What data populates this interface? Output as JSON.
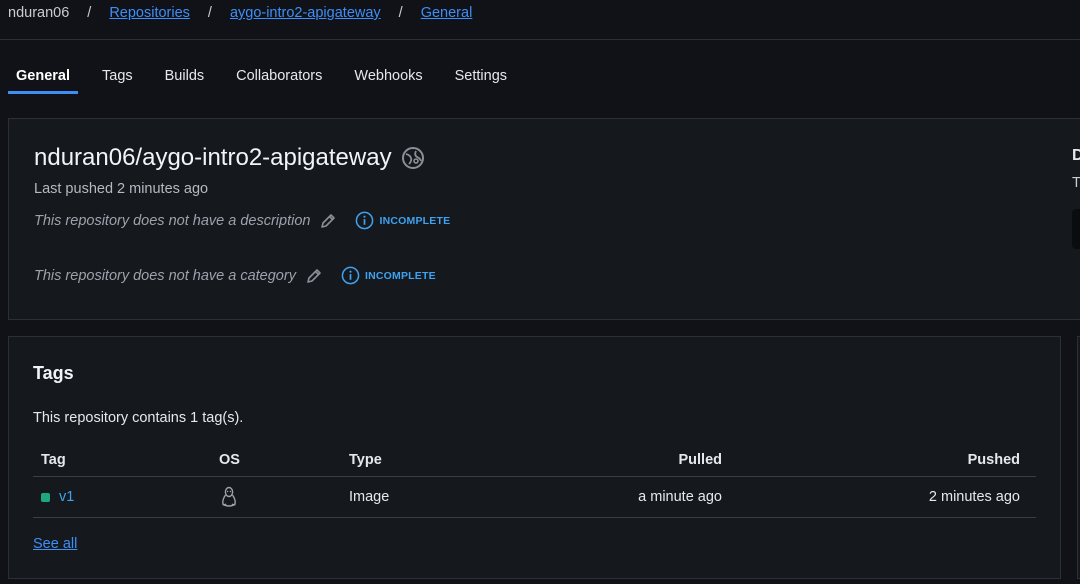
{
  "breadcrumb": {
    "user": "nduran06",
    "separator": "/",
    "items": [
      "Repositories",
      "aygo-intro2-apigateway",
      "General"
    ]
  },
  "tabs": [
    "General",
    "Tags",
    "Builds",
    "Collaborators",
    "Webhooks",
    "Settings"
  ],
  "active_tab": "General",
  "repo": {
    "title": "nduran06/aygo-intro2-apigateway",
    "last_pushed": "Last pushed 2 minutes ago",
    "description_text": "This repository does not have a description",
    "category_text": "This repository does not have a category",
    "incomplete_label": "INCOMPLETE"
  },
  "side_panel": {
    "heading": "D",
    "text": "T"
  },
  "tags": {
    "title": "Tags",
    "count_text": "This repository contains 1 tag(s).",
    "columns": [
      "Tag",
      "OS",
      "Type",
      "Pulled",
      "Pushed"
    ],
    "rows": [
      {
        "tag": "v1",
        "os": "linux-icon",
        "type": "Image",
        "pulled": "a minute ago",
        "pushed": "2 minutes ago"
      }
    ],
    "see_all": "See all"
  },
  "colors": {
    "background": "#101217",
    "card": "#15181d",
    "accent": "#3e8ef7",
    "incomplete": "#3ea2f0",
    "status_active": "#1ea882"
  }
}
